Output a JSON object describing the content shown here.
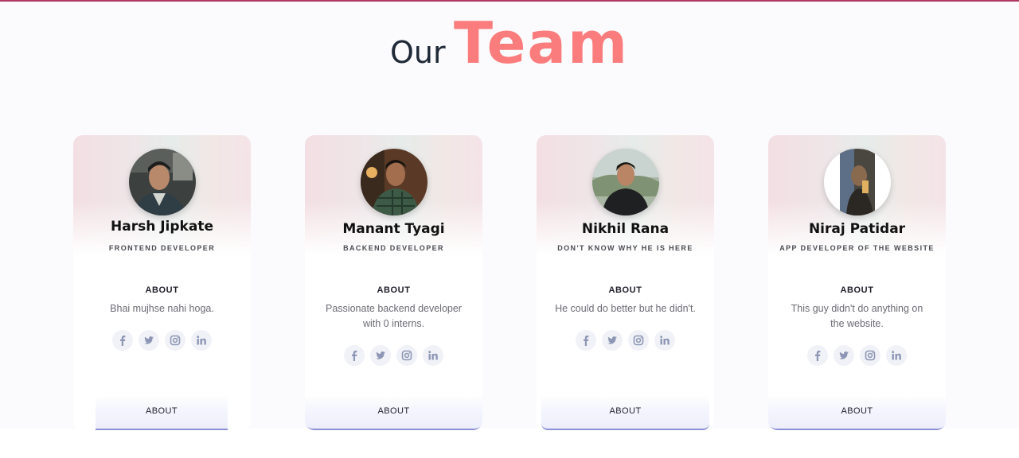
{
  "heading": {
    "prefix": "Our",
    "highlight": "Team"
  },
  "colors": {
    "accent": "#fb7c7c",
    "top_border": "#b03a64",
    "button_underline": "#8c8ed6"
  },
  "members": [
    {
      "name": "Harsh Jipkate",
      "role": "FRONTEND DEVELOPER",
      "about_title": "ABOUT",
      "about_text": "Bhai mujhse nahi hoga.",
      "button_label": "ABOUT"
    },
    {
      "name": "Manant Tyagi",
      "role": "BACKEND DEVELOPER",
      "about_title": "ABOUT",
      "about_text": "Passionate backend developer with 0 interns.",
      "button_label": "ABOUT"
    },
    {
      "name": "Nikhil Rana",
      "role": "DON'T KNOW WHY HE IS HERE",
      "about_title": "ABOUT",
      "about_text": "He could do better but he didn't.",
      "button_label": "ABOUT"
    },
    {
      "name": "Niraj Patidar",
      "role": "APP DEVELOPER OF THE WEBSITE",
      "about_title": "ABOUT",
      "about_text": "This guy didn't do anything on the website.",
      "button_label": "ABOUT"
    }
  ],
  "social_icons": [
    "facebook-icon",
    "twitter-icon",
    "instagram-icon",
    "linkedin-icon"
  ]
}
